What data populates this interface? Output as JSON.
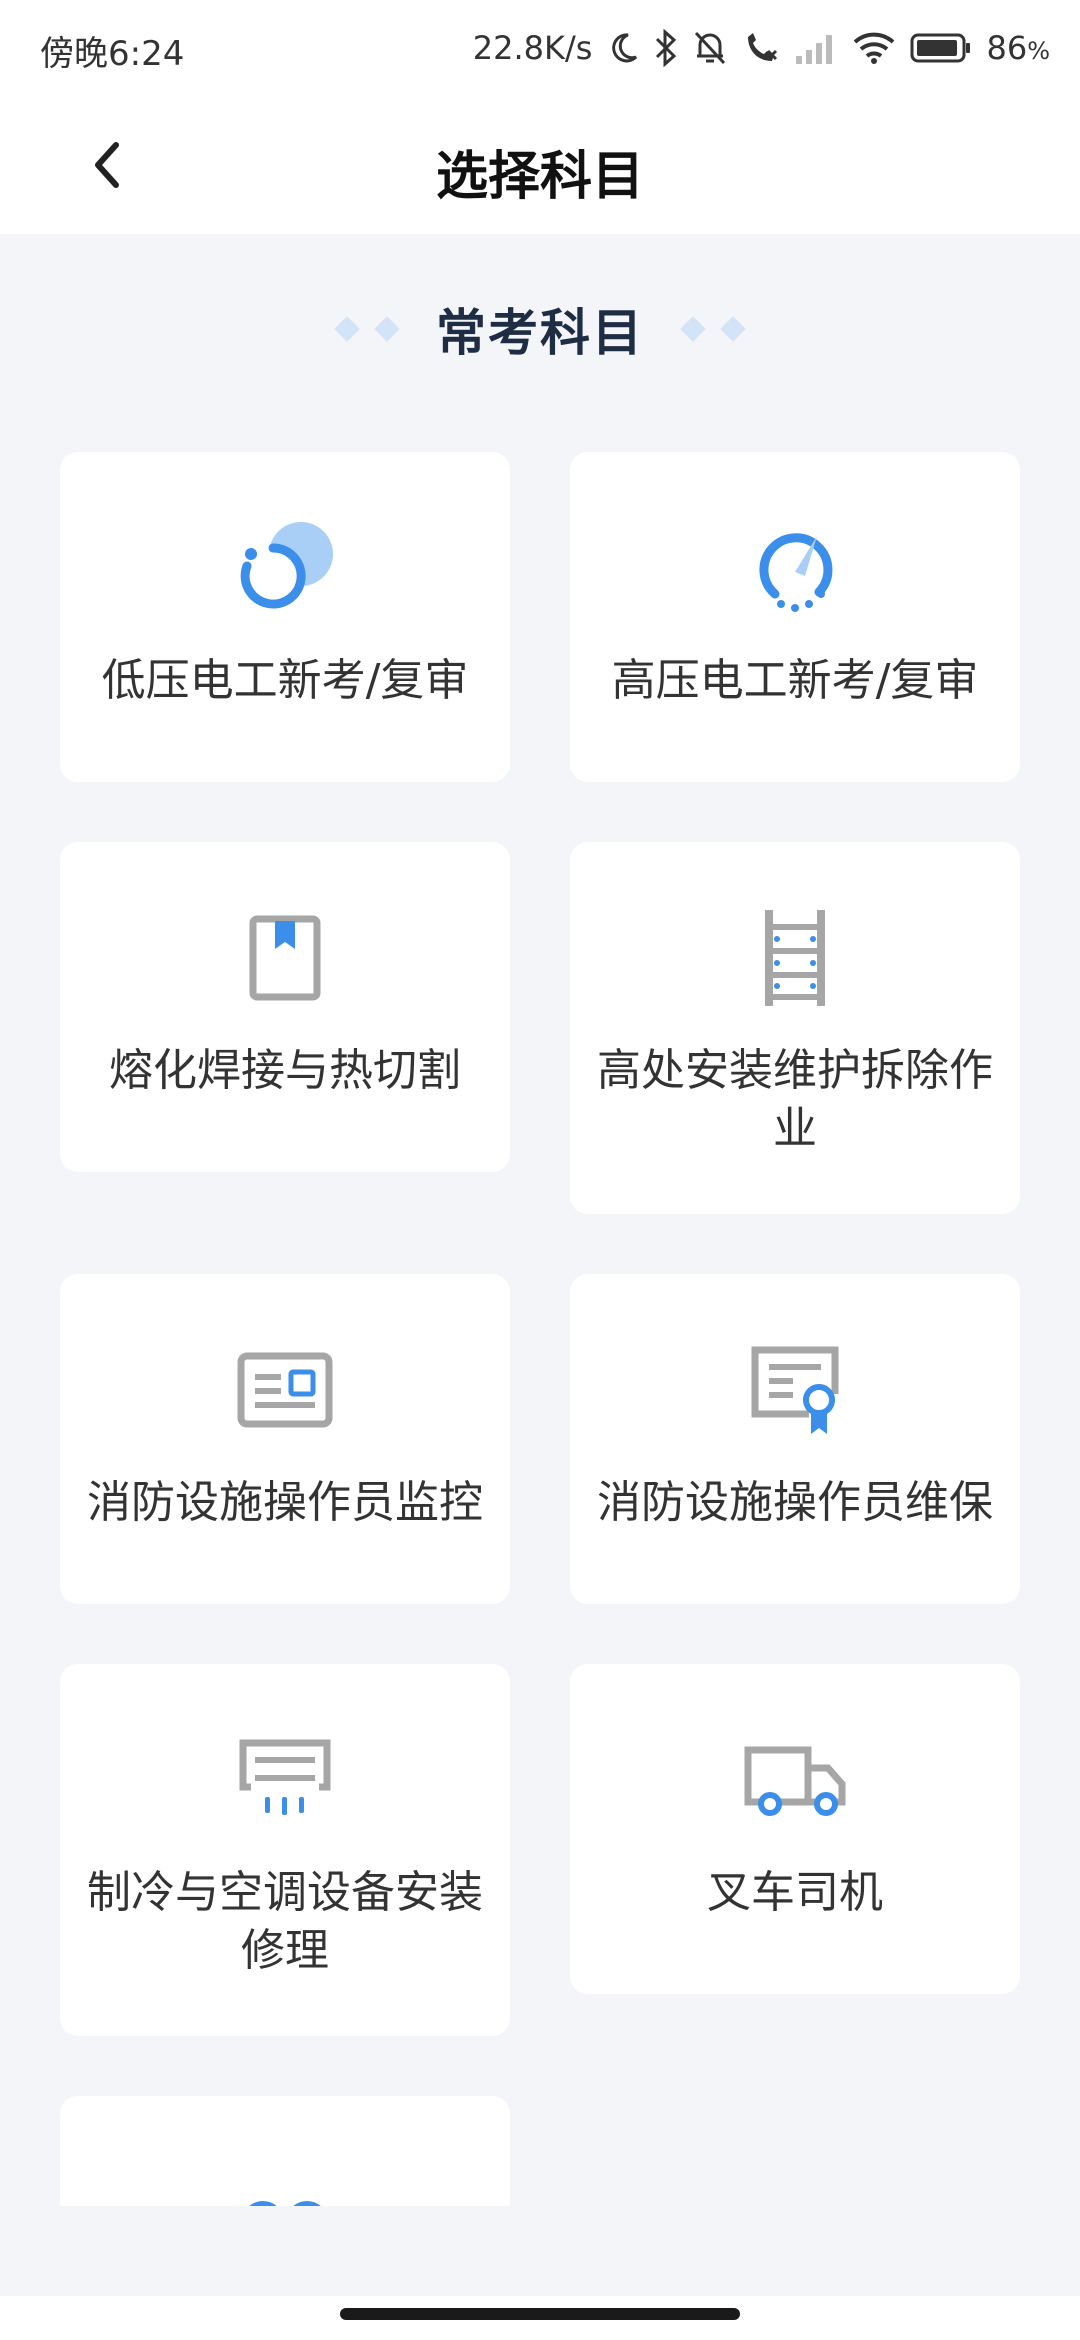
{
  "status_bar": {
    "time": "傍晚6:24",
    "network_speed": "22.8K/s",
    "battery": "86",
    "battery_unit": "%"
  },
  "header": {
    "title": "选择科目",
    "back_icon": "chevron-left-icon"
  },
  "section": {
    "title": "常考科目"
  },
  "subjects": [
    {
      "label": "低压电工新考/复审",
      "icon": "low-voltage-icon"
    },
    {
      "label": "高压电工新考/复审",
      "icon": "high-voltage-gauge-icon"
    },
    {
      "label": "熔化焊接与热切割",
      "icon": "bookmark-book-icon"
    },
    {
      "label": "高处安装维护拆除作业",
      "icon": "ladder-icon"
    },
    {
      "label": "消防设施操作员监控",
      "icon": "id-card-icon"
    },
    {
      "label": "消防设施操作员维保",
      "icon": "certificate-icon"
    },
    {
      "label": "制冷与空调设备安装修理",
      "icon": "air-conditioner-icon"
    },
    {
      "label": "叉车司机",
      "icon": "truck-icon"
    },
    {
      "label": "",
      "icon": "chain-link-icon"
    }
  ],
  "colors": {
    "accent_blue": "#3b8eea",
    "light_blue": "#a9cff7",
    "icon_gray": "#a6a6a6",
    "background": "#f4f5f8",
    "card": "#ffffff"
  }
}
